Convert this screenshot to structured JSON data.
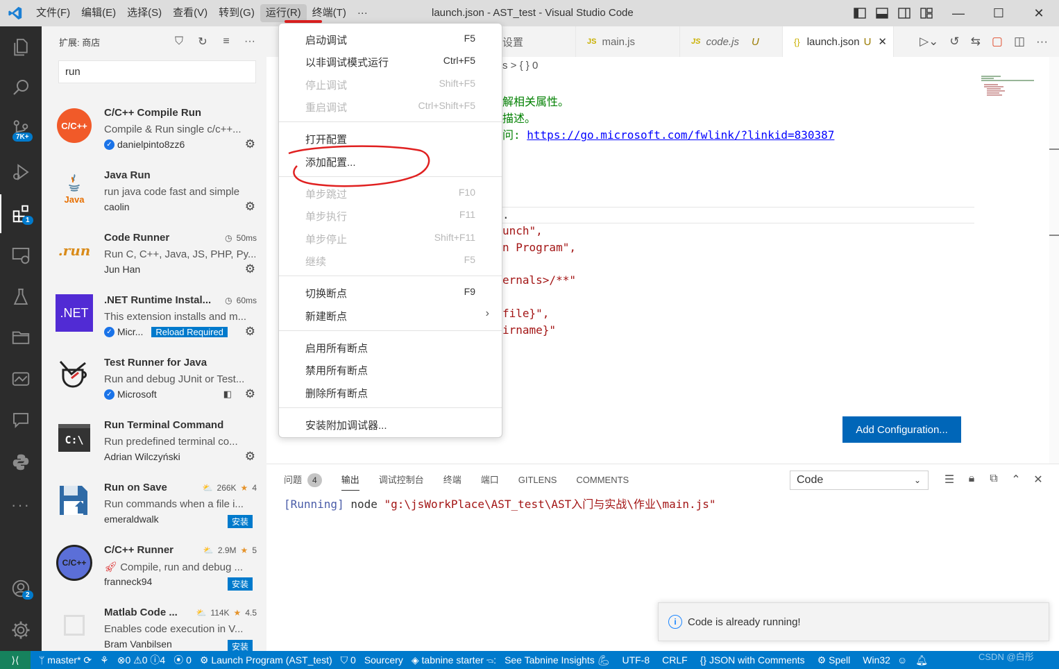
{
  "titlebar": {
    "menus": [
      "文件(F)",
      "编辑(E)",
      "选择(S)",
      "查看(V)",
      "转到(G)",
      "运行(R)",
      "终端(T)",
      "···"
    ],
    "title": "launch.json - AST_test - Visual Studio Code",
    "minimize": "—",
    "maximize": "☐",
    "close": "✕"
  },
  "activity": {
    "source_control_badge": "7K+",
    "extensions_badge": "1",
    "accounts_badge": "2"
  },
  "sidebar": {
    "title": "扩展: 商店",
    "search_value": "run",
    "extensions": [
      {
        "name": "C/C++ Compile Run",
        "desc": "Compile & Run single c/c++...",
        "publisher": "danielpinto8zz6",
        "verified": true,
        "meta": "",
        "action": "gear",
        "icon_text": "C/C++"
      },
      {
        "name": "Java Run",
        "desc": "run java code fast and simple",
        "publisher": "caolin",
        "verified": false,
        "meta": "",
        "action": "gear",
        "icon_text": "Java"
      },
      {
        "name": "Code Runner",
        "desc": "Run C, C++, Java, JS, PHP, Py...",
        "publisher": "Jun Han",
        "verified": false,
        "meta": "50ms",
        "action": "gear",
        "icon_text": ".run"
      },
      {
        "name": ".NET Runtime Instal...",
        "desc": "This extension installs and m...",
        "publisher": "Micr...",
        "verified": true,
        "meta": "60ms",
        "action": "gear",
        "reload": "Reload Required",
        "icon_text": ".NET"
      },
      {
        "name": "Test Runner for Java",
        "desc": "Run and debug JUnit or Test...",
        "publisher": "Microsoft",
        "verified": true,
        "meta": "",
        "action": "gear",
        "icon_text": ""
      },
      {
        "name": "Run Terminal Command",
        "desc": "Run predefined terminal co...",
        "publisher": "Adrian Wilczyński",
        "verified": false,
        "meta": "",
        "action": "gear",
        "icon_text": "C:\\"
      },
      {
        "name": "Run on Save",
        "desc": "Run commands when a file i...",
        "publisher": "emeraldwalk",
        "verified": false,
        "downloads": "266K",
        "rating": "4",
        "action": "install",
        "install_label": "安装",
        "icon_text": ""
      },
      {
        "name": "C/C++ Runner",
        "desc": "Compile, run and debug ...",
        "publisher": "franneck94",
        "verified": false,
        "downloads": "2.9M",
        "rating": "5",
        "action": "install",
        "install_label": "安装",
        "icon_text": "C/C++"
      },
      {
        "name": "Matlab Code ...",
        "desc": "Enables code execution in V...",
        "publisher": "Bram Vanbilsen",
        "verified": false,
        "downloads": "114K",
        "rating": "4.5",
        "action": "install",
        "install_label": "安装",
        "icon_text": ""
      }
    ]
  },
  "tabs": [
    {
      "label": "设置",
      "type": "settings"
    },
    {
      "label": "main.js",
      "type": "js"
    },
    {
      "label": "code.js",
      "type": "js",
      "modified": "U"
    },
    {
      "label": "launch.json",
      "type": "json",
      "modified": "U",
      "active": true
    }
  ],
  "editor": {
    "breadcrumb": "s > { } 0",
    "comment1": "解相关属性。",
    "comment2": "描述。",
    "comment3_prefix": "问: ",
    "comment3_link": "https://go.microsoft.com/fwlink/?linkid=830387",
    "dot": ".",
    "line_launch": "unch\",",
    "line_program": "n Program\",",
    "line_internals": "ernals>/**\"",
    "line_file": "file}\",",
    "line_dirname": "irname}\"",
    "add_config_button": "Add Configuration..."
  },
  "runmenu": {
    "items": [
      {
        "label": "启动调试",
        "key": "F5",
        "disabled": false
      },
      {
        "label": "以非调试模式运行",
        "key": "Ctrl+F5",
        "disabled": false
      },
      {
        "label": "停止调试",
        "key": "Shift+F5",
        "disabled": true
      },
      {
        "label": "重启调试",
        "key": "Ctrl+Shift+F5",
        "disabled": true
      },
      {
        "label": "打开配置",
        "key": "",
        "disabled": false
      },
      {
        "label": "添加配置...",
        "key": "",
        "disabled": false
      },
      {
        "label": "单步跳过",
        "key": "F10",
        "disabled": true
      },
      {
        "label": "单步执行",
        "key": "F11",
        "disabled": true
      },
      {
        "label": "单步停止",
        "key": "Shift+F11",
        "disabled": true
      },
      {
        "label": "继续",
        "key": "F5",
        "disabled": true
      },
      {
        "label": "切换断点",
        "key": "F9",
        "disabled": false
      },
      {
        "label": "新建断点",
        "key": "",
        "disabled": false,
        "submenu": true
      },
      {
        "label": "启用所有断点",
        "key": "",
        "disabled": false
      },
      {
        "label": "禁用所有断点",
        "key": "",
        "disabled": false
      },
      {
        "label": "删除所有断点",
        "key": "",
        "disabled": false
      },
      {
        "label": "安装附加调试器...",
        "key": "",
        "disabled": false
      }
    ]
  },
  "panel": {
    "tabs": [
      "问题",
      "输出",
      "调试控制台",
      "终端",
      "端口",
      "GITLENS",
      "COMMENTS"
    ],
    "problems_count": "4",
    "active_tab": "输出",
    "channel": "Code",
    "output_running": "[Running]",
    "output_cmd": "node",
    "output_path": "\"g:\\jsWorkPlace\\AST_test\\AST入门与实战\\作业\\main.js\""
  },
  "toast": {
    "message": "Code is already running!"
  },
  "statusbar": {
    "branch": "master*",
    "errors": "0",
    "warnings": "0",
    "infos": "4",
    "ports": "0",
    "launch": "Launch Program (AST_test)",
    "shield": "0",
    "sourcery": "Sourcery",
    "tabnine": "tabnine starter",
    "tabnine_insights": "See Tabnine Insights",
    "encoding": "UTF-8",
    "eol": "CRLF",
    "language": "JSON with Comments",
    "spell": "Spell",
    "platform": "Win32",
    "watermark": "CSDN @白彤"
  },
  "colors": {
    "accent": "#007acc",
    "annotation": "#e02020",
    "titlebar_bg": "#dddddd",
    "activity_bg": "#2c2c2c"
  }
}
